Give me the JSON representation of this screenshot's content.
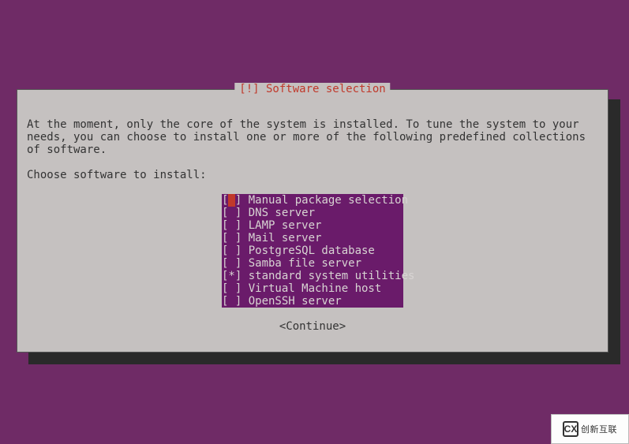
{
  "dialog": {
    "title": "[!] Software selection",
    "intro": "At the moment, only the core of the system is installed. To tune the system to your needs, you can choose to install one or more of the following predefined collections of software.",
    "prompt": "Choose software to install:",
    "options": [
      {
        "label": "Manual package selection",
        "selected": false,
        "focused": true
      },
      {
        "label": "DNS server",
        "selected": false,
        "focused": false
      },
      {
        "label": "LAMP server",
        "selected": false,
        "focused": false
      },
      {
        "label": "Mail server",
        "selected": false,
        "focused": false
      },
      {
        "label": "PostgreSQL database",
        "selected": false,
        "focused": false
      },
      {
        "label": "Samba file server",
        "selected": false,
        "focused": false
      },
      {
        "label": "standard system utilities",
        "selected": true,
        "focused": false
      },
      {
        "label": "Virtual Machine host",
        "selected": false,
        "focused": false
      },
      {
        "label": "OpenSSH server",
        "selected": false,
        "focused": false
      }
    ],
    "continue": "<Continue>"
  },
  "watermark": {
    "logo": "CX",
    "text": "创新互联"
  }
}
